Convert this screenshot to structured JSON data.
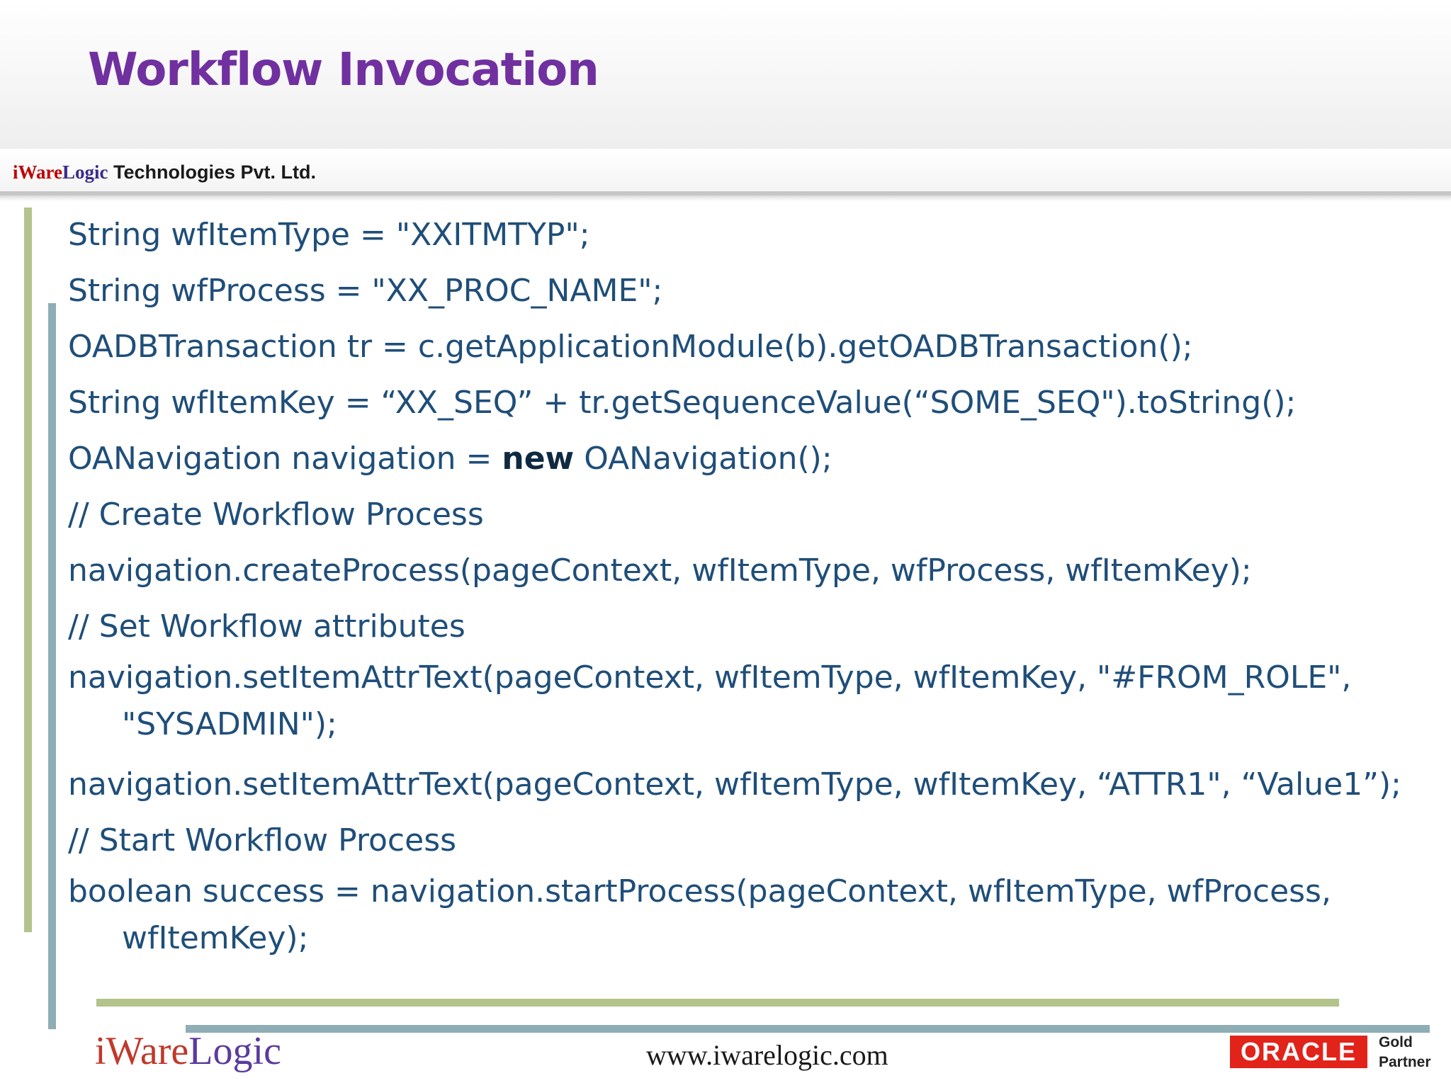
{
  "slide": {
    "title": "Workflow Invocation"
  },
  "company": {
    "brand_i": "iWare",
    "brand_logic": "Logic",
    "rest": " Technologies Pvt. Ltd."
  },
  "code": {
    "line1": "String wfItemType = \"XXITMTYP\";",
    "line2": "String wfProcess = \"XX_PROC_NAME\";",
    "line3": "OADBTransaction tr = c.getApplicationModule(b).getOADBTransaction();",
    "line4": "String wfItemKey = “XX_SEQ” + tr.getSequenceValue(“SOME_SEQ\").toString();",
    "line5_a": "OANavigation navigation = ",
    "line5_kw": "new",
    "line5_b": " OANavigation();",
    "line6": "// Create Workflow Process",
    "line7": "navigation.createProcess(pageContext, wfItemType, wfProcess, wfItemKey);",
    "line8": "// Set Workflow attributes",
    "line9_a": "navigation.setItemAttrText(pageContext, wfItemType, wfItemKey, \"#FROM_ROLE\",",
    "line9_b": "\"SYSADMIN\");",
    "line10": "navigation.setItemAttrText(pageContext, wfItemType, wfItemKey, “ATTR1\", “Value1”);",
    "line11": "// Start Workflow Process",
    "line12_a": "boolean success = navigation.startProcess(pageContext, wfItemType, wfProcess,",
    "line12_b": "wfItemKey);"
  },
  "footer": {
    "logo_i": "iWare",
    "logo_logic": "Logic",
    "url": "www.iwarelogic.com",
    "oracle": "ORACLE",
    "partner_line1": "Gold",
    "partner_line2": "Partner"
  },
  "colors": {
    "title": "#7030a0",
    "code_text": "#1f4e79",
    "accent_green": "#b4c28c",
    "accent_teal": "#8fadb4",
    "oracle_red": "#e2231a"
  }
}
